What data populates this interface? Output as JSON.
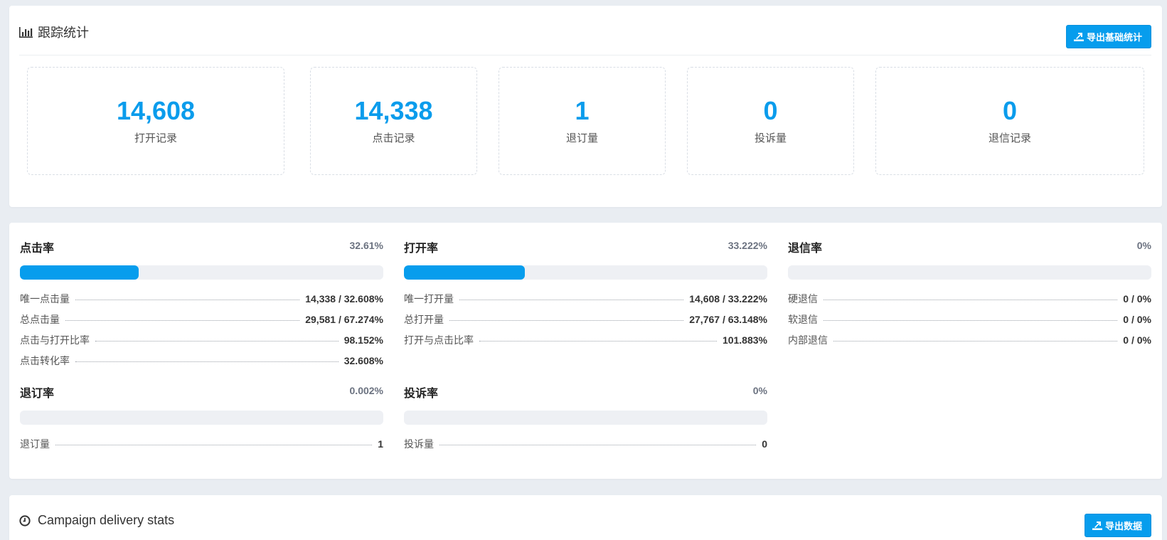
{
  "tracking": {
    "title": "跟踪统计",
    "export_label": "导出基础统计",
    "stats": [
      {
        "value": "14,608",
        "label": "打开记录"
      },
      {
        "value": "14,338",
        "label": "点击记录"
      },
      {
        "value": "1",
        "label": "退订量"
      },
      {
        "value": "0",
        "label": "投诉量"
      },
      {
        "value": "0",
        "label": "退信记录"
      }
    ]
  },
  "rates": {
    "click": {
      "name": "点击率",
      "value": "32.61%",
      "progress": 0.3261,
      "rows": [
        {
          "label": "唯一点击量",
          "value": "14,338 / 32.608%"
        },
        {
          "label": "总点击量",
          "value": "29,581 / 67.274%"
        },
        {
          "label": "点击与打开比率",
          "value": "98.152%"
        },
        {
          "label": "点击转化率",
          "value": "32.608%"
        }
      ]
    },
    "open": {
      "name": "打开率",
      "value": "33.222%",
      "progress": 0.33222,
      "rows": [
        {
          "label": "唯一打开量",
          "value": "14,608 / 33.222%"
        },
        {
          "label": "总打开量",
          "value": "27,767 / 63.148%"
        },
        {
          "label": "打开与点击比率",
          "value": "101.883%"
        }
      ]
    },
    "bounce": {
      "name": "退信率",
      "value": "0%",
      "progress": 0,
      "rows": [
        {
          "label": "硬退信",
          "value": "0 / 0%"
        },
        {
          "label": "软退信",
          "value": "0 / 0%"
        },
        {
          "label": "内部退信",
          "value": "0 / 0%"
        }
      ]
    },
    "unsubscribe": {
      "name": "退订率",
      "value": "0.002%",
      "progress": 2e-05,
      "rows": [
        {
          "label": "退订量",
          "value": "1"
        }
      ]
    },
    "complaint": {
      "name": "投诉率",
      "value": "0%",
      "progress": 0,
      "rows": [
        {
          "label": "投诉量",
          "value": "0"
        }
      ]
    }
  },
  "delivery": {
    "title": "Campaign delivery stats",
    "export_label": "导出数据"
  },
  "colors": {
    "accent": "#079ded",
    "stat_value": "#0a9cec",
    "track": "#eef0f4"
  }
}
